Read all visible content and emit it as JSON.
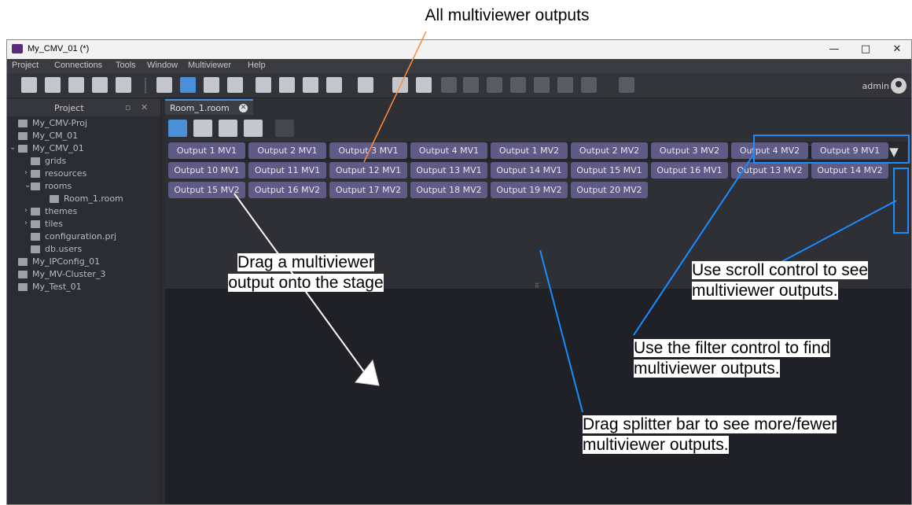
{
  "annotations": {
    "top": "All multiviewer outputs",
    "drag_output_1": "Drag a multiviewer",
    "drag_output_2": "output onto the stage",
    "scroll_1": "Use scroll control to see",
    "scroll_2": "multiviewer outputs.",
    "filter_1": "Use the filter control to find",
    "filter_2": "multiviewer outputs.",
    "splitter_1": "Drag splitter bar to see more/fewer",
    "splitter_2": "multiviewer outputs."
  },
  "window": {
    "title": "My_CMV_01 (*)",
    "minimize": "—",
    "maximize": "□",
    "close": "✕"
  },
  "menu": [
    "Project",
    "Connections",
    "Tools",
    "Window",
    "Multiviewer",
    "Help"
  ],
  "toolbar": {
    "user": "admin"
  },
  "sidebar": {
    "title": "Project",
    "items": [
      "My_CMV-Proj",
      "My_CM_01",
      "My_CMV_01",
      "grids",
      "resources",
      "rooms",
      "Room_1.room",
      "themes",
      "tiles",
      "configuration.prj",
      "db.users",
      "My_IPConfig_01",
      "My_MV-Cluster_3",
      "My_Test_01"
    ]
  },
  "editor": {
    "tab_label": "Room_1.room",
    "filter_placeholder": "filter"
  },
  "outputs": [
    "Output 1 MV1",
    "Output 2 MV1",
    "Output 3 MV1",
    "Output 4 MV1",
    "Output 1 MV2",
    "Output 2 MV2",
    "Output 3 MV2",
    "Output 4 MV2",
    "Output 9 MV1",
    "Output 10 MV1",
    "Output 11 MV1",
    "Output 12 MV1",
    "Output 13 MV1",
    "Output 14 MV1",
    "Output 15 MV1",
    "Output 16 MV1",
    "Output 13 MV2",
    "Output 14 MV2",
    "Output 15 MV2",
    "Output 16 MV2",
    "Output 17 MV2",
    "Output 18 MV2",
    "Output 19 MV2",
    "Output 20 MV2"
  ],
  "colors": {
    "accent": "#4a90d9",
    "output_button": "#605a86",
    "annotation_line_orange": "#ff8c3a",
    "annotation_line_blue": "#1a8cff"
  }
}
